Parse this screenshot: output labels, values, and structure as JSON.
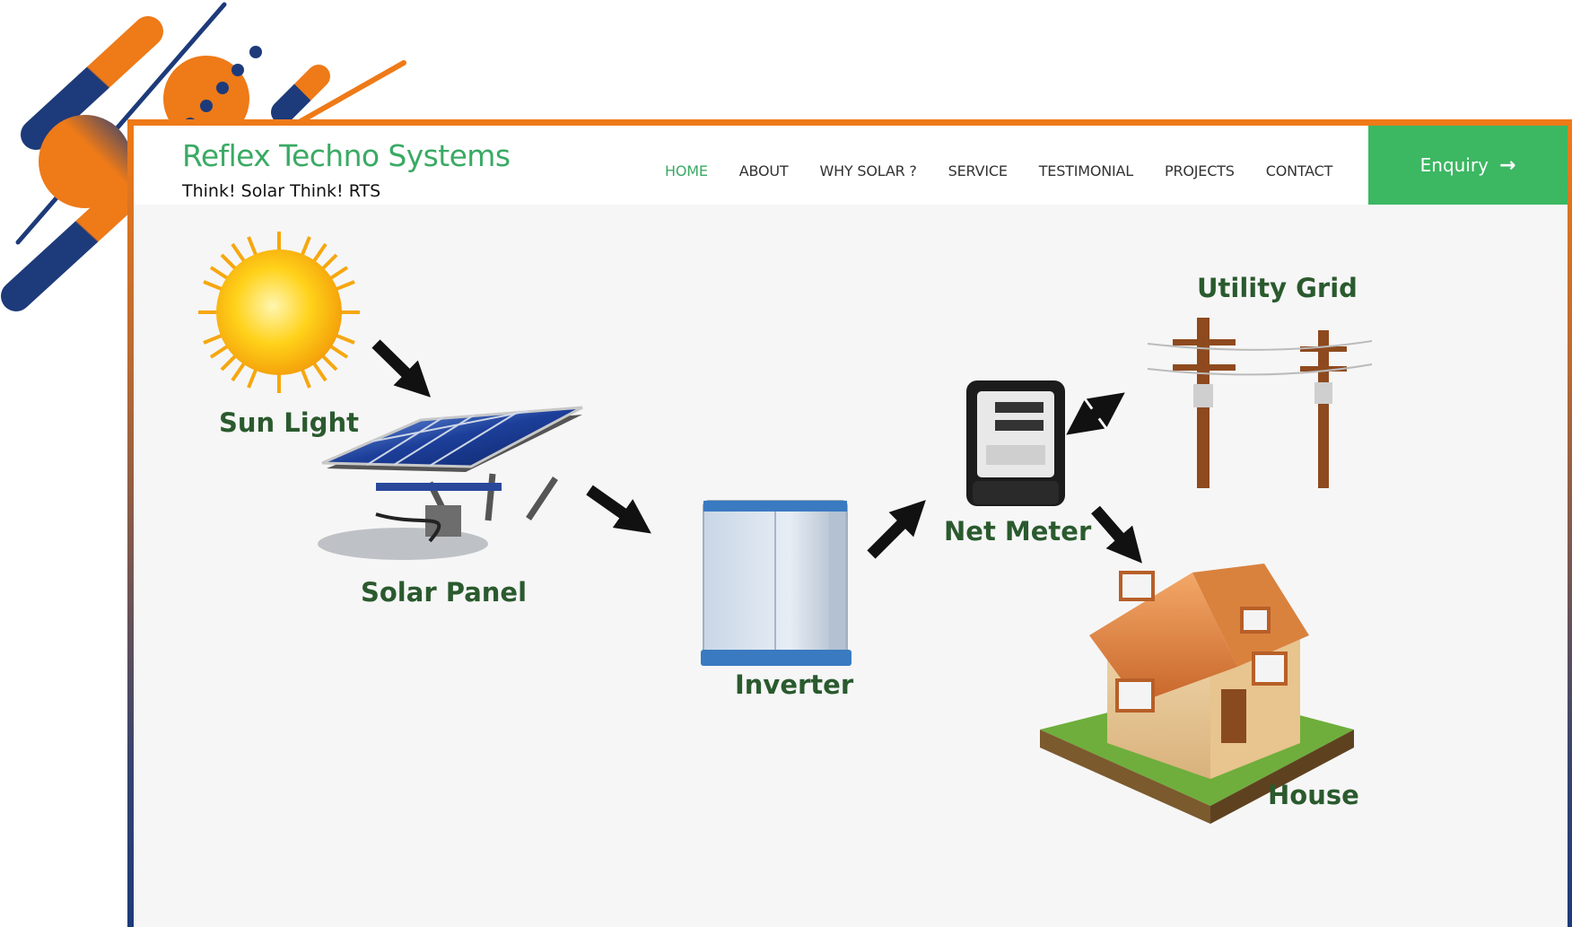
{
  "header": {
    "brand_title": "Reflex Techno Systems",
    "brand_tagline": "Think! Solar Think! RTS"
  },
  "nav": {
    "items": [
      {
        "label": "HOME",
        "active": true
      },
      {
        "label": "ABOUT",
        "active": false
      },
      {
        "label": "WHY SOLAR ?",
        "active": false
      },
      {
        "label": "SERVICE",
        "active": false
      },
      {
        "label": "TESTIMONIAL",
        "active": false
      },
      {
        "label": "PROJECTS",
        "active": false
      },
      {
        "label": "CONTACT",
        "active": false
      }
    ],
    "enquiry_label": "Enquiry"
  },
  "diagram": {
    "labels": {
      "sun": "Sun Light",
      "panel": "Solar Panel",
      "inverter": "Inverter",
      "meter": "Net Meter",
      "grid": "Utility Grid",
      "house": "House"
    }
  },
  "colors": {
    "brand_green": "#3aaa64",
    "button_green": "#3cb762",
    "label_green": "#2a5a2e",
    "deco_orange": "#ee7a18",
    "deco_navy": "#1d3a7a"
  }
}
